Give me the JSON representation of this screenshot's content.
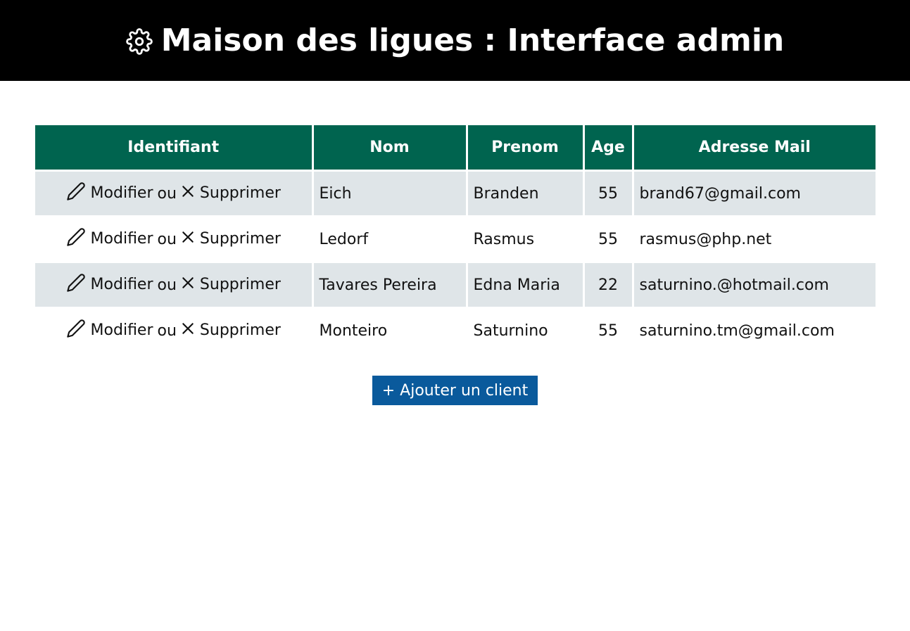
{
  "header": {
    "title": "Maison des ligues : Interface admin",
    "icon": "gear-icon"
  },
  "table": {
    "columns": [
      "Identifiant",
      "Nom",
      "Prenom",
      "Age",
      "Adresse Mail"
    ],
    "action_labels": {
      "modify": "Modifier",
      "or": "ou",
      "delete": "Supprimer"
    },
    "rows": [
      {
        "nom": "Eich",
        "prenom": "Branden",
        "age": "55",
        "mail": "brand67@gmail.com"
      },
      {
        "nom": "Ledorf",
        "prenom": "Rasmus",
        "age": "55",
        "mail": "rasmus@php.net"
      },
      {
        "nom": "Tavares Pereira",
        "prenom": "Edna Maria",
        "age": "22",
        "mail": "saturnino.@hotmail.com"
      },
      {
        "nom": "Monteiro",
        "prenom": "Saturnino",
        "age": "55",
        "mail": "saturnino.tm@gmail.com"
      }
    ]
  },
  "add_button": {
    "label": "+ Ajouter un client"
  },
  "colors": {
    "header_bg": "#000000",
    "table_header_bg": "#00644f",
    "row_alt_bg": "#dfe5e8",
    "button_bg": "#0a5a9c"
  }
}
